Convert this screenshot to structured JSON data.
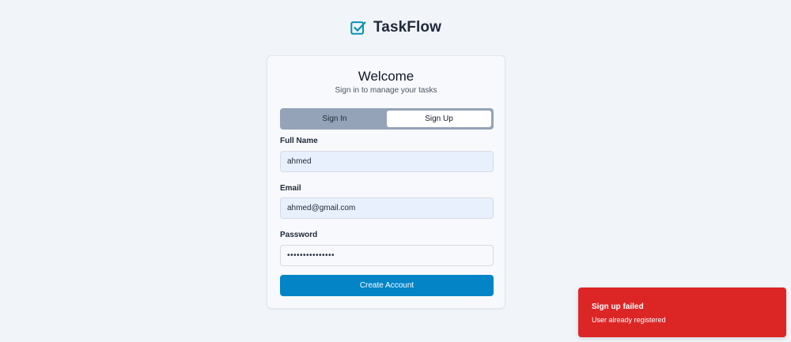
{
  "brand": {
    "name": "TaskFlow",
    "icon": "checkbox-check-icon",
    "color": "#0891b2"
  },
  "card": {
    "title": "Welcome",
    "subtitle": "Sign in to manage your tasks",
    "tabs": [
      {
        "label": "Sign In",
        "active": false
      },
      {
        "label": "Sign Up",
        "active": true
      }
    ],
    "fields": {
      "full_name": {
        "label": "Full Name",
        "value": "ahmed"
      },
      "email": {
        "label": "Email",
        "value": "ahmed@gmail.com"
      },
      "password": {
        "label": "Password",
        "value": "•••••••••••••••"
      }
    },
    "submit_label": "Create Account"
  },
  "toast": {
    "title": "Sign up failed",
    "message": "User already registered",
    "color": "#dc2626"
  },
  "colors": {
    "accent": "#0284c7",
    "background": "#f1f4f9"
  }
}
